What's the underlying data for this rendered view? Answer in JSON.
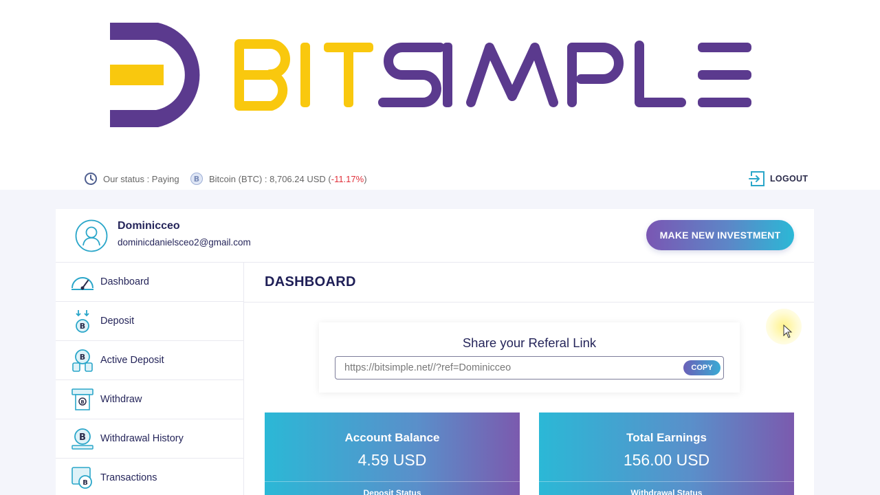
{
  "brand": {
    "part1": "BIT",
    "part2": "SIMPLE",
    "color_purple": "#5b3a8e",
    "color_yellow": "#f9c80e"
  },
  "status": {
    "status_text": "Our status : Paying",
    "btc_text": "Bitcoin (BTC) : 8,706.24 USD (",
    "btc_change": "-11.17%",
    "btc_close": ")",
    "logout_label": "LOGOUT"
  },
  "user": {
    "name": "Dominicceo",
    "email": "dominicdanielsceo2@gmail.com",
    "invest_button": "MAKE NEW INVESTMENT"
  },
  "sidebar": {
    "items": [
      {
        "label": "Dashboard",
        "icon": "speedometer-icon"
      },
      {
        "label": "Deposit",
        "icon": "bitcoin-deposit-icon"
      },
      {
        "label": "Active Deposit",
        "icon": "bitcoin-stack-icon"
      },
      {
        "label": "Withdraw",
        "icon": "atm-withdraw-icon"
      },
      {
        "label": "Withdrawal History",
        "icon": "bitcoin-history-icon"
      },
      {
        "label": "Transactions",
        "icon": "transactions-icon"
      }
    ]
  },
  "main": {
    "title": "DASHBOARD",
    "referral": {
      "title": "Share your Referal Link",
      "link": "https://bitsimple.net//?ref=Dominicceo",
      "copy_label": "COPY"
    },
    "stats": [
      {
        "title": "Account Balance",
        "value": "4.59 USD",
        "sub": "Deposit Status"
      },
      {
        "title": "Total Earnings",
        "value": "156.00 USD",
        "sub": "Withdrawal Status"
      }
    ]
  },
  "colors": {
    "accent_gradient_start": "#2bb8d6",
    "accent_gradient_end": "#7b5aae",
    "text_dark": "#25255a",
    "negative": "#e0303a"
  }
}
